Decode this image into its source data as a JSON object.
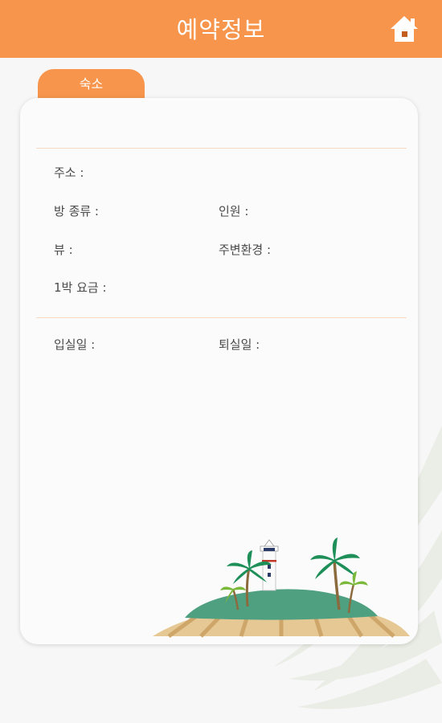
{
  "header": {
    "title": "예약정보",
    "home_icon": "home-icon"
  },
  "tab": {
    "label": "숙소"
  },
  "details": {
    "address_label": "주소 :",
    "room_type_label": "방 종류 :",
    "guests_label": "인원 :",
    "view_label": "뷰 :",
    "surroundings_label": "주변환경 :",
    "price_label": "1박 요금 :",
    "checkin_label": "입실일 :",
    "checkout_label": "퇴실일 :"
  },
  "colors": {
    "accent": "#f6954b",
    "background": "#f7f7f7",
    "card": "#fbfbfb",
    "divider": "#f8d9c4"
  }
}
